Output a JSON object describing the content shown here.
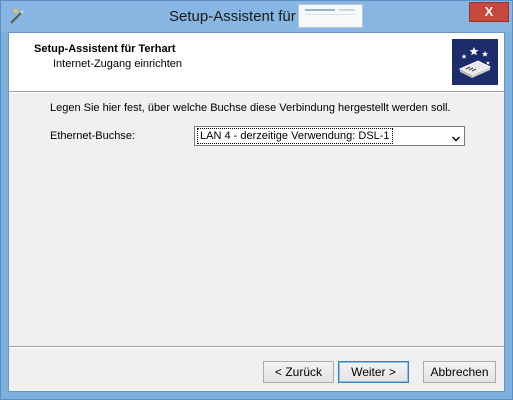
{
  "window": {
    "title": "Setup-Assistent für",
    "close_label": "X",
    "title_icon": "wizard-wand-icon"
  },
  "header": {
    "title": "Setup-Assistent für Terhart",
    "subtitle": "Internet-Zugang einrichten",
    "logo_icon": "wizard-stars-icon"
  },
  "main": {
    "instruction": "Legen Sie hier fest, über welche Buchse diese Verbindung hergestellt werden soll.",
    "ethernet_label": "Ethernet-Buchse:",
    "ethernet_select_value": "LAN 4 - derzeitige Verwendung: DSL-1"
  },
  "buttons": {
    "back": "< Zurück",
    "next": "Weiter >",
    "cancel": "Abbrechen"
  },
  "colors": {
    "titlebar": "#86b6e1",
    "close": "#c7483d",
    "logo_bg": "#1d2d6b"
  }
}
